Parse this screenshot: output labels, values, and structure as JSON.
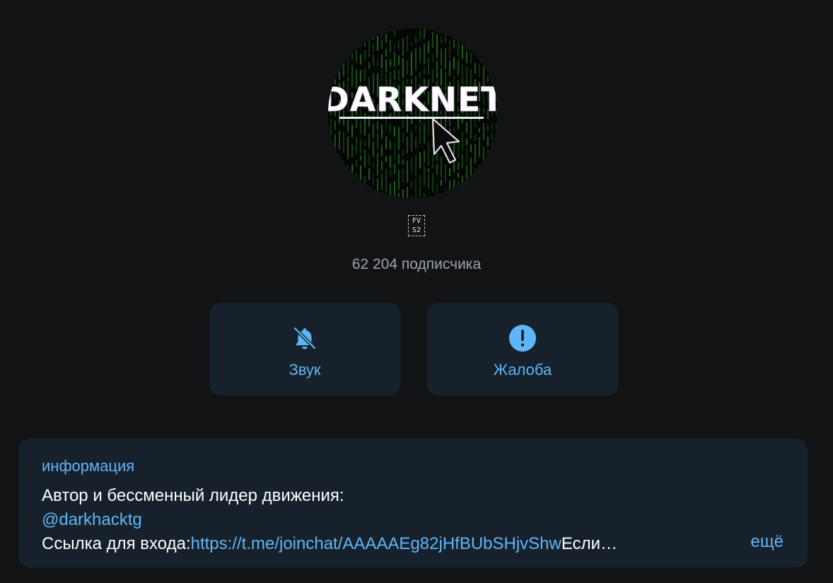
{
  "channel": {
    "avatar_text": "DARKNET",
    "name_glyph_top": "FV",
    "name_glyph_bottom": "S2",
    "subscribers": "62 204 подписчика"
  },
  "actions": {
    "sound_label": "Звук",
    "report_label": "Жалоба"
  },
  "info": {
    "title": "информация",
    "line1": "Автор и бессменный лидер движения:",
    "mention": "@darkhacktg",
    "line3_prefix": "Ссылка для входа:",
    "line3_link": "https://t.me/joinchat/AAAAAEg82jHfBUbSHjvShw",
    "line3_suffix": "Если…",
    "more_label": "ещё"
  },
  "colors": {
    "background": "#121315",
    "card": "#17212b",
    "accent": "#5eb5f7",
    "muted": "#9aa3ad"
  },
  "icons": {
    "sound": "bell-slash-icon",
    "report": "exclamation-circle-icon"
  }
}
